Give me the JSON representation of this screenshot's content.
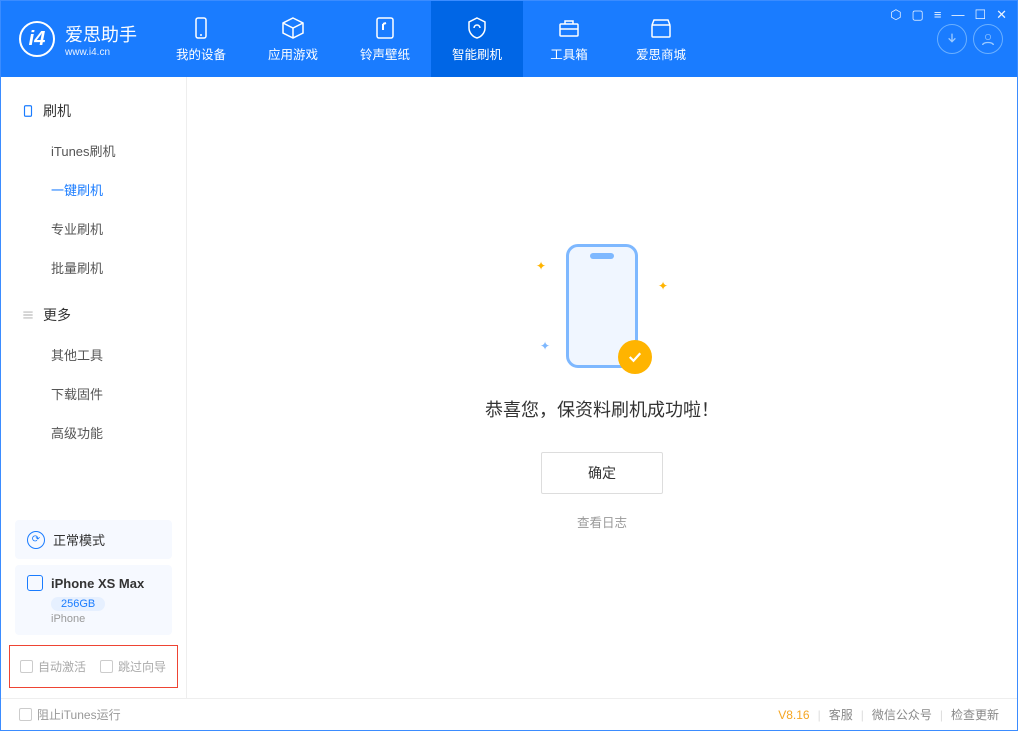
{
  "app": {
    "name": "爱思助手",
    "url": "www.i4.cn"
  },
  "nav": {
    "tabs": [
      {
        "label": "我的设备"
      },
      {
        "label": "应用游戏"
      },
      {
        "label": "铃声壁纸"
      },
      {
        "label": "智能刷机"
      },
      {
        "label": "工具箱"
      },
      {
        "label": "爱思商城"
      }
    ]
  },
  "sidebar": {
    "section1": {
      "title": "刷机",
      "items": [
        "iTunes刷机",
        "一键刷机",
        "专业刷机",
        "批量刷机"
      ]
    },
    "section2": {
      "title": "更多",
      "items": [
        "其他工具",
        "下载固件",
        "高级功能"
      ]
    },
    "mode": "正常模式",
    "device": {
      "name": "iPhone XS Max",
      "storage": "256GB",
      "type": "iPhone"
    },
    "options": {
      "autoActivate": "自动激活",
      "skipGuide": "跳过向导"
    }
  },
  "main": {
    "message": "恭喜您，保资料刷机成功啦！",
    "okButton": "确定",
    "logLink": "查看日志"
  },
  "footer": {
    "blockItunes": "阻止iTunes运行",
    "version": "V8.16",
    "links": [
      "客服",
      "微信公众号",
      "检查更新"
    ]
  }
}
